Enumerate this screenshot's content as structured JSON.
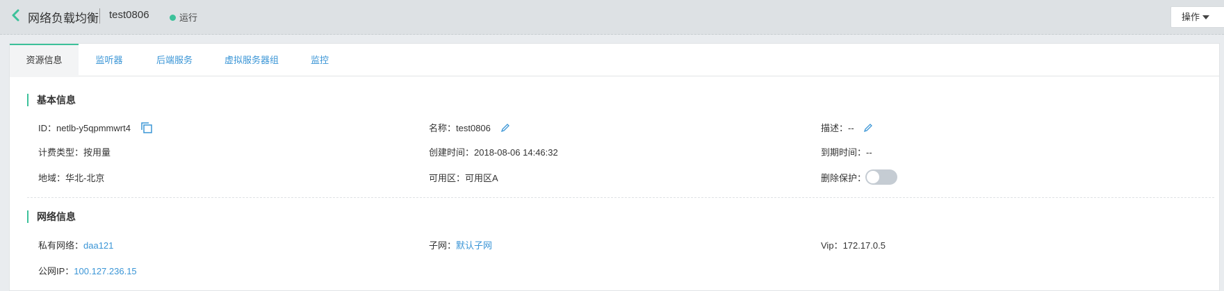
{
  "header": {
    "app_title": "网络负载均衡",
    "instance_name": "test0806",
    "status": "运行",
    "status_color": "#3cc19a",
    "operations_label": "操作"
  },
  "tabs": [
    {
      "label": "资源信息",
      "active": true
    },
    {
      "label": "监听器",
      "active": false
    },
    {
      "label": "后端服务",
      "active": false
    },
    {
      "label": "虚拟服务器组",
      "active": false
    },
    {
      "label": "监控",
      "active": false
    }
  ],
  "basic_info": {
    "title": "基本信息",
    "id_label": "ID：",
    "id_value": "netlb-y5qpmmwrt4",
    "name_label": "名称：",
    "name_value": "test0806",
    "desc_label": "描述：",
    "desc_value": "--",
    "billing_label": "计费类型：",
    "billing_value": "按用量",
    "created_label": "创建时间：",
    "created_value": "2018-08-06 14:46:32",
    "expire_label": "到期时间：",
    "expire_value": "--",
    "region_label": "地域：",
    "region_value": "华北-北京",
    "az_label": "可用区：",
    "az_value": "可用区A",
    "delete_protect_label": "删除保护：",
    "delete_protect_on": false
  },
  "network_info": {
    "title": "网络信息",
    "vpc_label": "私有网络：",
    "vpc_value": "daa121",
    "subnet_label": "子网：",
    "subnet_value": "默认子网",
    "vip_label": "Vip：",
    "vip_value": "172.17.0.5",
    "public_ip_label": "公网IP：",
    "public_ip_value": "100.127.236.15"
  },
  "icons": {
    "back": "chevron-left-icon",
    "copy": "copy-icon",
    "edit": "pencil-icon",
    "caret": "caret-down-icon"
  },
  "colors": {
    "accent": "#3cc19a",
    "link": "#3a95d6"
  }
}
